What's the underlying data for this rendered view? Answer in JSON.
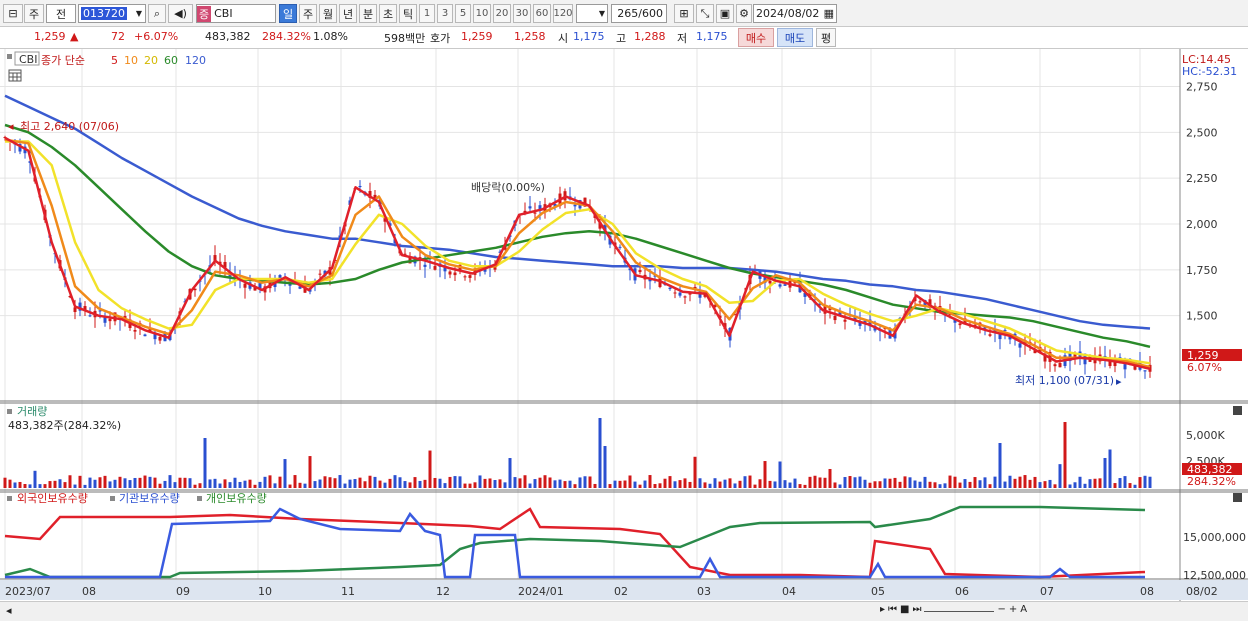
{
  "toolbar": {
    "type": "주",
    "prev": "전",
    "code": "013720",
    "name": "CBI",
    "seg_badge": "증",
    "periods": [
      "일",
      "주",
      "월",
      "년",
      "분",
      "초",
      "틱"
    ],
    "nums": [
      "1",
      "3",
      "5",
      "10",
      "20",
      "30",
      "60",
      "120"
    ],
    "count": "265",
    "total": "/600",
    "date": "2024/08/02"
  },
  "quote": {
    "price": "1,259",
    "change": "72",
    "pct": "+6.07%",
    "vol": "483,382",
    "vol_pct": "284.32%",
    "turn": "1.08%",
    "amount": "598백만",
    "bid_label": "호가",
    "ask": "1,259",
    "bid": "1,258",
    "open_label": "시",
    "open": "1,175",
    "high_label": "고",
    "high": "1,288",
    "low_label": "저",
    "low": "1,175",
    "buy": "매수",
    "sell": "매도",
    "eval": "평"
  },
  "main": {
    "tag": "CBI",
    "legend_ma": "종가 단순",
    "ma": [
      "5",
      "10",
      "20",
      "60",
      "120"
    ],
    "lc": "LC:14.45",
    "hc": "HC:-52.31",
    "max_label": "최고 2,640 (07/06)",
    "min_label": "최저 1,100 (07/31)",
    "div_label": "배당락(0.00%)",
    "price_tag": "1,259",
    "pct_tag": "6.07%",
    "yticks": [
      "2,750",
      "2,500",
      "2,250",
      "2,000",
      "1,750",
      "1,500"
    ]
  },
  "volume": {
    "title": "거래량",
    "value": "483,382주(284.32%)",
    "yticks": [
      "5,000K",
      "2,500K"
    ],
    "tag1": "483,382",
    "tag2": "284.32%"
  },
  "holders": {
    "foreign": "외국인보유수량",
    "inst": "기관보유수량",
    "indiv": "개인보유수량",
    "yticks": [
      "15,000,000",
      "12,500,000"
    ]
  },
  "xaxis": [
    "2023/07",
    "08",
    "09",
    "10",
    "11",
    "12",
    "2024/01",
    "02",
    "03",
    "04",
    "05",
    "06",
    "07",
    "08",
    "08/02"
  ],
  "chart_data": {
    "type": "candlestick",
    "title": "CBI",
    "y_range": [
      1100,
      2900
    ],
    "high": 2640,
    "high_date": "07/06",
    "low": 1100,
    "low_date": "07/31",
    "last": 1259,
    "series": [
      {
        "name": "5",
        "color": "#e0202a",
        "values": [
          2470,
          2400,
          1900,
          1550,
          1500,
          1480,
          1420,
          1380,
          1640,
          1800,
          1700,
          1640,
          1710,
          1640,
          1760,
          2200,
          2120,
          1830,
          1800,
          1760,
          1730,
          1780,
          2050,
          2080,
          2150,
          2100,
          1900,
          1720,
          1690,
          1630,
          1620,
          1390,
          1740,
          1690,
          1660,
          1530,
          1490,
          1450,
          1390,
          1610,
          1520,
          1460,
          1420,
          1390,
          1320,
          1250,
          1270,
          1260,
          1240,
          1210
        ]
      },
      {
        "name": "10",
        "color": "#f08a1a",
        "values": [
          2460,
          2440,
          2100,
          1660,
          1540,
          1490,
          1440,
          1400,
          1530,
          1740,
          1720,
          1680,
          1700,
          1660,
          1720,
          2050,
          2150,
          1930,
          1830,
          1780,
          1750,
          1770,
          1950,
          2060,
          2120,
          2100,
          1960,
          1790,
          1710,
          1660,
          1630,
          1480,
          1650,
          1720,
          1680,
          1560,
          1510,
          1470,
          1420,
          1560,
          1540,
          1480,
          1440,
          1400,
          1340,
          1270,
          1270,
          1260,
          1250,
          1220
        ]
      },
      {
        "name": "20",
        "color": "#f2e22a",
        "values": [
          2450,
          2450,
          2320,
          1900,
          1640,
          1540,
          1480,
          1430,
          1450,
          1640,
          1700,
          1700,
          1700,
          1680,
          1700,
          1890,
          2050,
          2000,
          1880,
          1800,
          1770,
          1770,
          1850,
          1970,
          2060,
          2080,
          2000,
          1840,
          1760,
          1700,
          1660,
          1570,
          1580,
          1690,
          1700,
          1620,
          1560,
          1510,
          1470,
          1500,
          1540,
          1510,
          1470,
          1430,
          1370,
          1310,
          1290,
          1270,
          1260,
          1240
        ]
      },
      {
        "name": "60",
        "color": "#2a8a2a",
        "values": [
          2540,
          2500,
          2420,
          2320,
          2200,
          2080,
          1960,
          1850,
          1770,
          1720,
          1700,
          1690,
          1680,
          1670,
          1680,
          1700,
          1750,
          1790,
          1810,
          1830,
          1850,
          1870,
          1900,
          1930,
          1950,
          1960,
          1950,
          1920,
          1880,
          1840,
          1800,
          1760,
          1730,
          1710,
          1690,
          1670,
          1640,
          1600,
          1560,
          1540,
          1520,
          1510,
          1500,
          1490,
          1470,
          1440,
          1410,
          1380,
          1360,
          1330
        ]
      },
      {
        "name": "120",
        "color": "#3a5bd0",
        "values": [
          2700,
          2640,
          2580,
          2520,
          2440,
          2360,
          2290,
          2220,
          2150,
          2090,
          2030,
          1990,
          1960,
          1940,
          1920,
          1920,
          1900,
          1880,
          1870,
          1860,
          1840,
          1820,
          1810,
          1800,
          1790,
          1780,
          1770,
          1770,
          1770,
          1760,
          1760,
          1760,
          1750,
          1740,
          1720,
          1700,
          1690,
          1670,
          1660,
          1640,
          1630,
          1610,
          1590,
          1560,
          1530,
          1500,
          1470,
          1450,
          1440,
          1430
        ]
      }
    ]
  }
}
